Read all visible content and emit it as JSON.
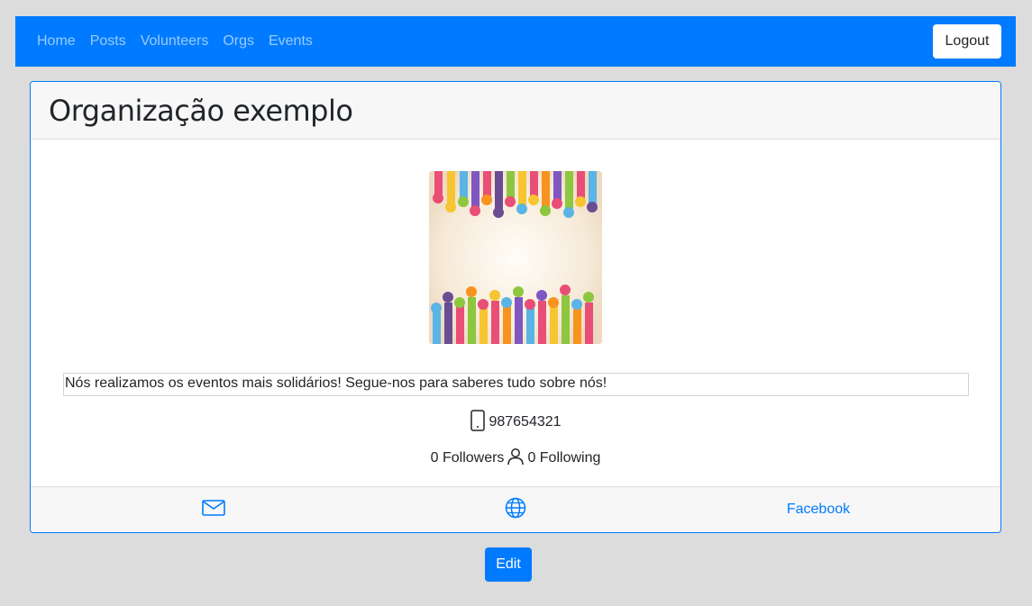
{
  "navbar": {
    "links": [
      "Home",
      "Posts",
      "Volunteers",
      "Orgs",
      "Events"
    ],
    "logout_label": "Logout",
    "bg_color": "#007bff"
  },
  "org": {
    "name": "Organização exemplo",
    "image_icon": "colorful-raised-hands-image",
    "description": "Nós realizamos os eventos mais solidários! Segue-nos para saberes tudo sobre nós!",
    "phone": "987654321",
    "followers": "0 Followers",
    "following": "0 Following"
  },
  "footer": {
    "email_icon": "envelope-icon",
    "website_icon": "globe-icon",
    "facebook_label": "Facebook"
  },
  "edit_label": "Edit"
}
